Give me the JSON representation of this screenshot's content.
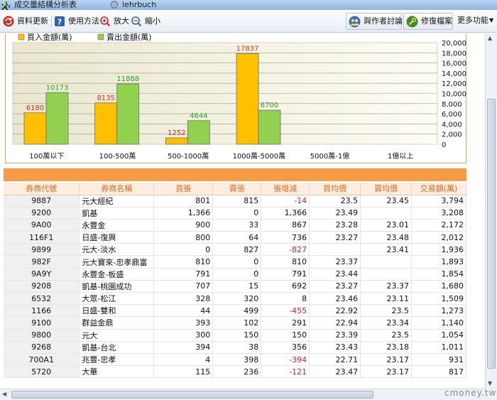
{
  "tabs": [
    {
      "label": "成交量結構分析表"
    },
    {
      "label": "lehrbuch"
    }
  ],
  "toolbar": {
    "refresh_label": "資料更新",
    "help_label": "使用方法",
    "zoom_in_label": "放大",
    "zoom_out_label": "縮小",
    "discuss_label": "與作者討論",
    "repair_label": "修復檔案",
    "more_label": "更多功能"
  },
  "chart_data": {
    "type": "bar",
    "categories": [
      "100萬以下",
      "100-500萬",
      "500-1000萬",
      "1000萬-5000萬",
      "5000萬-1億",
      "1億以上"
    ],
    "series": [
      {
        "name": "買入金額(萬)",
        "values": [
          6180,
          8135,
          1252,
          17837,
          0,
          0
        ],
        "color": "#ffc000"
      },
      {
        "name": "賣出金額(萬)",
        "values": [
          10173,
          11888,
          4644,
          6700,
          0,
          0
        ],
        "color": "#92d050"
      }
    ],
    "label_colors": {
      "buy": "#e03020",
      "sell": "#2e9e2e"
    },
    "y_ticks": [
      "20,000",
      "18,000",
      "16,000",
      "14,000",
      "12,000",
      "10,000",
      "8,000",
      "6,000",
      "4,000",
      "2,000",
      "0"
    ],
    "ylim": [
      0,
      20000
    ],
    "legend_position": "top-left",
    "grid": true
  },
  "table": {
    "headers": [
      "券商代號",
      "券商名稱",
      "買張",
      "賣張",
      "張增減",
      "買均價",
      "賣均價",
      "交易額(萬)"
    ],
    "rows": [
      [
        "9887",
        "元大經紀",
        "801",
        "815",
        "-14",
        "23.5",
        "23.45",
        "3,794"
      ],
      [
        "9200",
        "凱基",
        "1,366",
        "0",
        "1,366",
        "23.49",
        "",
        "3,208"
      ],
      [
        "9A00",
        "永豐金",
        "900",
        "33",
        "867",
        "23.28",
        "23.01",
        "2,172"
      ],
      [
        "116F1",
        "日盛-復興",
        "800",
        "64",
        "736",
        "23.27",
        "23.48",
        "2,012"
      ],
      [
        "9899",
        "元大-淡水",
        "0",
        "827",
        "-827",
        "",
        "23.41",
        "1,936"
      ],
      [
        "982F",
        "元大寶來-忠孝鼎富",
        "810",
        "0",
        "810",
        "23.37",
        "",
        "1,893"
      ],
      [
        "9A9Y",
        "永豐金-板盛",
        "791",
        "0",
        "791",
        "23.44",
        "",
        "1,854"
      ],
      [
        "9208",
        "凱基-桃園成功",
        "707",
        "15",
        "692",
        "23.27",
        "23.37",
        "1,680"
      ],
      [
        "6532",
        "大眾-松江",
        "328",
        "320",
        "8",
        "23.46",
        "23.11",
        "1,509"
      ],
      [
        "1166",
        "日盛-雙和",
        "44",
        "499",
        "-455",
        "22.92",
        "23.5",
        "1,273"
      ],
      [
        "9100",
        "群益金鼎",
        "393",
        "102",
        "291",
        "22.94",
        "23.34",
        "1,140"
      ],
      [
        "9800",
        "元大",
        "300",
        "150",
        "150",
        "23.39",
        "23.5",
        "1,054"
      ],
      [
        "9268",
        "凱基-台北",
        "394",
        "38",
        "356",
        "23.43",
        "23.18",
        "1,011"
      ],
      [
        "700A1",
        "兆豐-忠孝",
        "4",
        "398",
        "-394",
        "22.71",
        "23.17",
        "931"
      ],
      [
        "5720",
        "大華",
        "115",
        "236",
        "-121",
        "23.47",
        "23.17",
        "817"
      ]
    ]
  },
  "watermark": "cmoney.tw",
  "colors": {
    "accent_orange": "#f79a45",
    "header_text": "#e2681a",
    "negative": "#e02020"
  }
}
